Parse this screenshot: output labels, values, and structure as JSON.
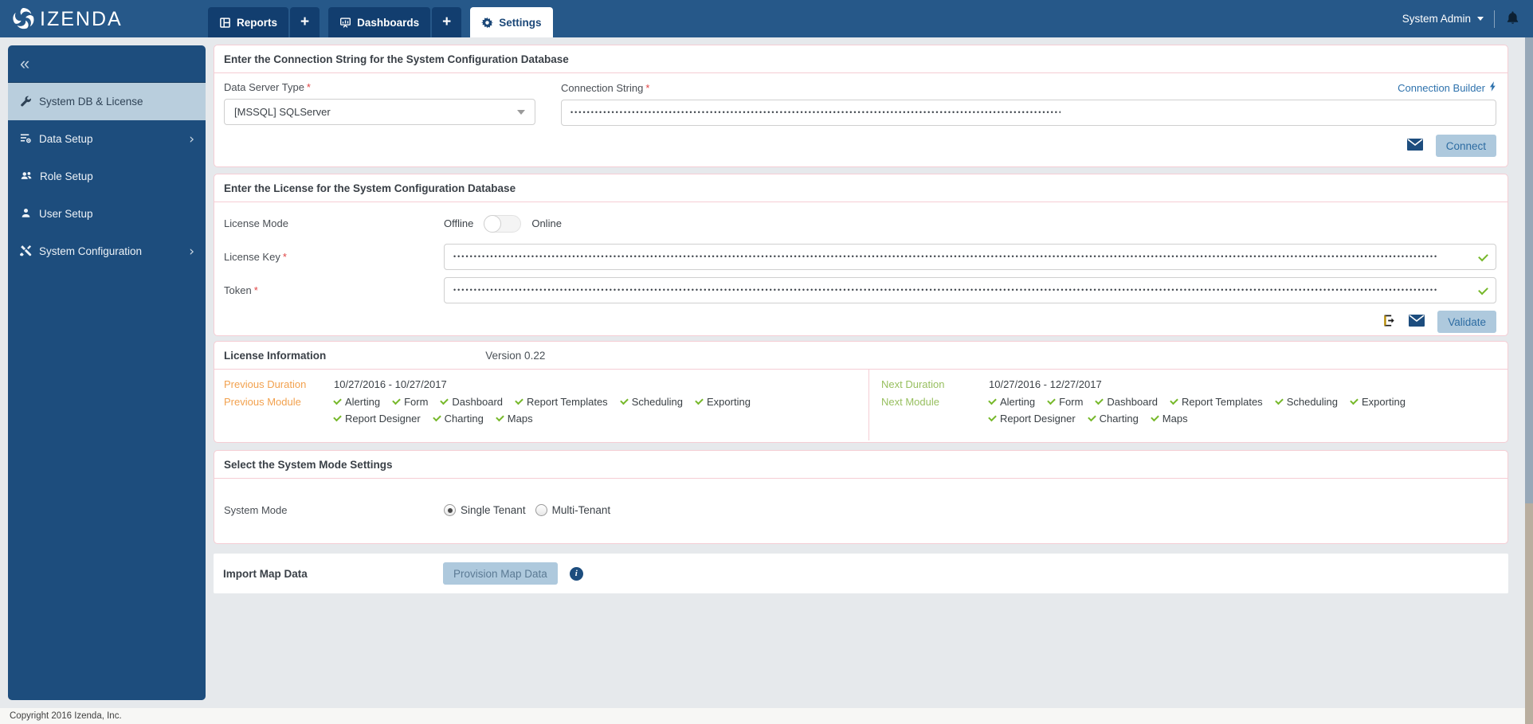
{
  "topbar": {
    "logo_text": "IZENDA",
    "tabs": {
      "reports": "Reports",
      "dashboards": "Dashboards",
      "settings": "Settings",
      "add": "+"
    },
    "user_menu": "System Admin"
  },
  "sidebar": {
    "collapse_icon": "«",
    "chevron": "›",
    "items": [
      {
        "label": "System DB & License"
      },
      {
        "label": "Data Setup"
      },
      {
        "label": "Role Setup"
      },
      {
        "label": "User Setup"
      },
      {
        "label": "System Configuration"
      }
    ]
  },
  "connection_section": {
    "title": "Enter the Connection String for the System Configuration Database",
    "required_marker": "*",
    "data_server_type_label": "Data Server Type",
    "data_server_type_value": "[MSSQL] SQLServer",
    "connection_string_label": "Connection String",
    "connection_string_masked": "••••••••••••••••••••••••••••••••••••••••••••••••••••••••••••••••••••••••••••••••••••••••••••••••••••••••••••••••••••••••",
    "connection_builder_link": "Connection Builder",
    "connect_button": "Connect"
  },
  "license_section": {
    "title": "Enter the License for the System Configuration Database",
    "required_marker": "*",
    "license_mode_label": "License Mode",
    "offline_label": "Offline",
    "online_label": "Online",
    "license_key_label": "License Key",
    "license_key_masked": "••••••••••••••••••••••••••••••••••••••••••••••••••••••••••••••••••••••••••••••••••••••••••••••••••••••••••••••••••••••••••••••••••••••••••••••••••••••••••••••••••••••••••••••••••••••••••••••••••••••••••••••••••••••••••••••••••••••••••••••••",
    "token_label": "Token",
    "token_masked": "••••••••••••••••••••••••••••••••••••••••••••••••••••••••••••••••••••••••••••••••••••••••••••••••••••••••••••••••••••••••••••••••••••••••••••••••••••••••••••••••••••••••••••••••••••••••••••••••••••••••••••••••••••••••••••••••••••••••••••••••",
    "validate_button": "Validate"
  },
  "license_info": {
    "title": "License Information",
    "version": "Version 0.22",
    "previous_duration_label": "Previous Duration",
    "previous_duration_value": "10/27/2016 - 10/27/2017",
    "previous_module_label": "Previous Module",
    "next_duration_label": "Next Duration",
    "next_duration_value": "10/27/2016 - 12/27/2017",
    "next_module_label": "Next Module",
    "modules": [
      "Alerting",
      "Form",
      "Dashboard",
      "Report Templates",
      "Scheduling",
      "Exporting",
      "Report Designer",
      "Charting",
      "Maps"
    ]
  },
  "system_mode_section": {
    "title": "Select the System Mode Settings",
    "label": "System Mode",
    "option_single": "Single Tenant",
    "option_multi": "Multi-Tenant",
    "selected": "Single Tenant"
  },
  "import_section": {
    "label": "Import Map Data",
    "button": "Provision Map Data"
  },
  "footer": {
    "copyright": "Copyright 2016 Izenda, Inc."
  },
  "colors": {
    "topbar_bg": "#265889",
    "tab_bg": "#123e6f",
    "sidebar_bg": "#1d4d7d",
    "sidebar_active_bg": "#b9cedd",
    "panel_border_pink": "#f5cdd4",
    "button_bg": "#aec9dd",
    "button_text": "#2d6ca2",
    "link_blue": "#2e72ad",
    "check_green": "#76b82a",
    "previous_orange": "#f2a14e",
    "next_green": "#97bf5f",
    "content_bg": "#e6e9ec",
    "icon_navy": "#1d4d7e"
  }
}
